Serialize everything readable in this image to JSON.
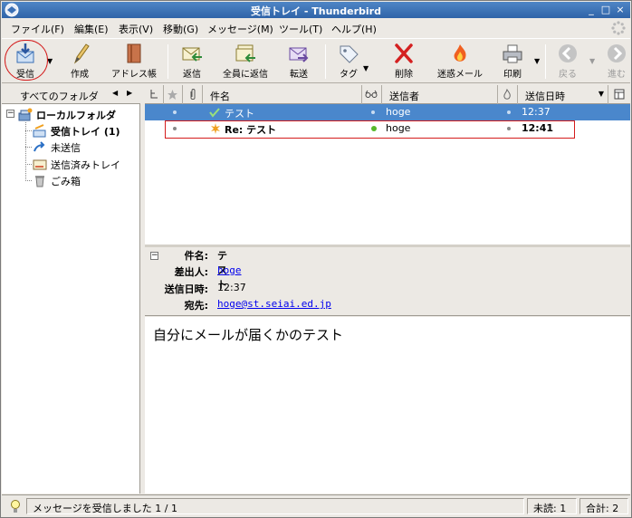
{
  "window": {
    "title": "受信トレイ - Thunderbird"
  },
  "titlebar_buttons": {
    "minimize": "_",
    "maximize": "□",
    "close": "×"
  },
  "menubar": {
    "items": [
      {
        "label": "ファイル(F)"
      },
      {
        "label": "編集(E)"
      },
      {
        "label": "表示(V)"
      },
      {
        "label": "移動(G)"
      },
      {
        "label": "メッセージ(M)"
      },
      {
        "label": "ツール(T)"
      },
      {
        "label": "ヘルプ(H)"
      }
    ]
  },
  "toolbar": {
    "get_mail": "受信",
    "write": "作成",
    "address_book": "アドレス帳",
    "reply": "返信",
    "reply_all": "全員に返信",
    "forward": "転送",
    "tag": "タグ",
    "delete": "削除",
    "junk": "迷惑メール",
    "print": "印刷",
    "back": "戻る",
    "forward_nav": "進む"
  },
  "folder_pane": {
    "header": "すべてのフォルダ",
    "folders": [
      {
        "label": "ローカルフォルダ",
        "icon": "local-folders-icon"
      },
      {
        "label": "受信トレイ (1)",
        "icon": "inbox-icon"
      },
      {
        "label": "未送信",
        "icon": "outbox-icon"
      },
      {
        "label": "送信済みトレイ",
        "icon": "sent-icon"
      },
      {
        "label": "ごみ箱",
        "icon": "trash-icon"
      }
    ]
  },
  "thread_pane": {
    "columns": {
      "subject": "件名",
      "sender": "送信者",
      "date": "送信日時"
    },
    "rows": [
      {
        "subject": "テスト",
        "sender": "hoge",
        "date": "12:37",
        "selected": true,
        "unread": false
      },
      {
        "subject": "Re: テスト",
        "sender": "hoge",
        "date": "12:41",
        "selected": false,
        "unread": true
      }
    ]
  },
  "message_header": {
    "subject_label": "件名:",
    "subject": "テスト",
    "from_label": "差出人:",
    "from": "hoge",
    "date_label": "送信日時:",
    "date": "12:37",
    "to_label": "宛先:",
    "to": "hoge@st.seiai.ed.jp"
  },
  "message_body": {
    "text": "自分にメールが届くかのテスト"
  },
  "statusbar": {
    "status": "メッセージを受信しました 1 / 1",
    "unread": "未読: 1",
    "total": "合計: 2"
  },
  "colors": {
    "selection": "#4a87cc",
    "annotation_red": "#d41c1c",
    "link": "#0000ee"
  }
}
